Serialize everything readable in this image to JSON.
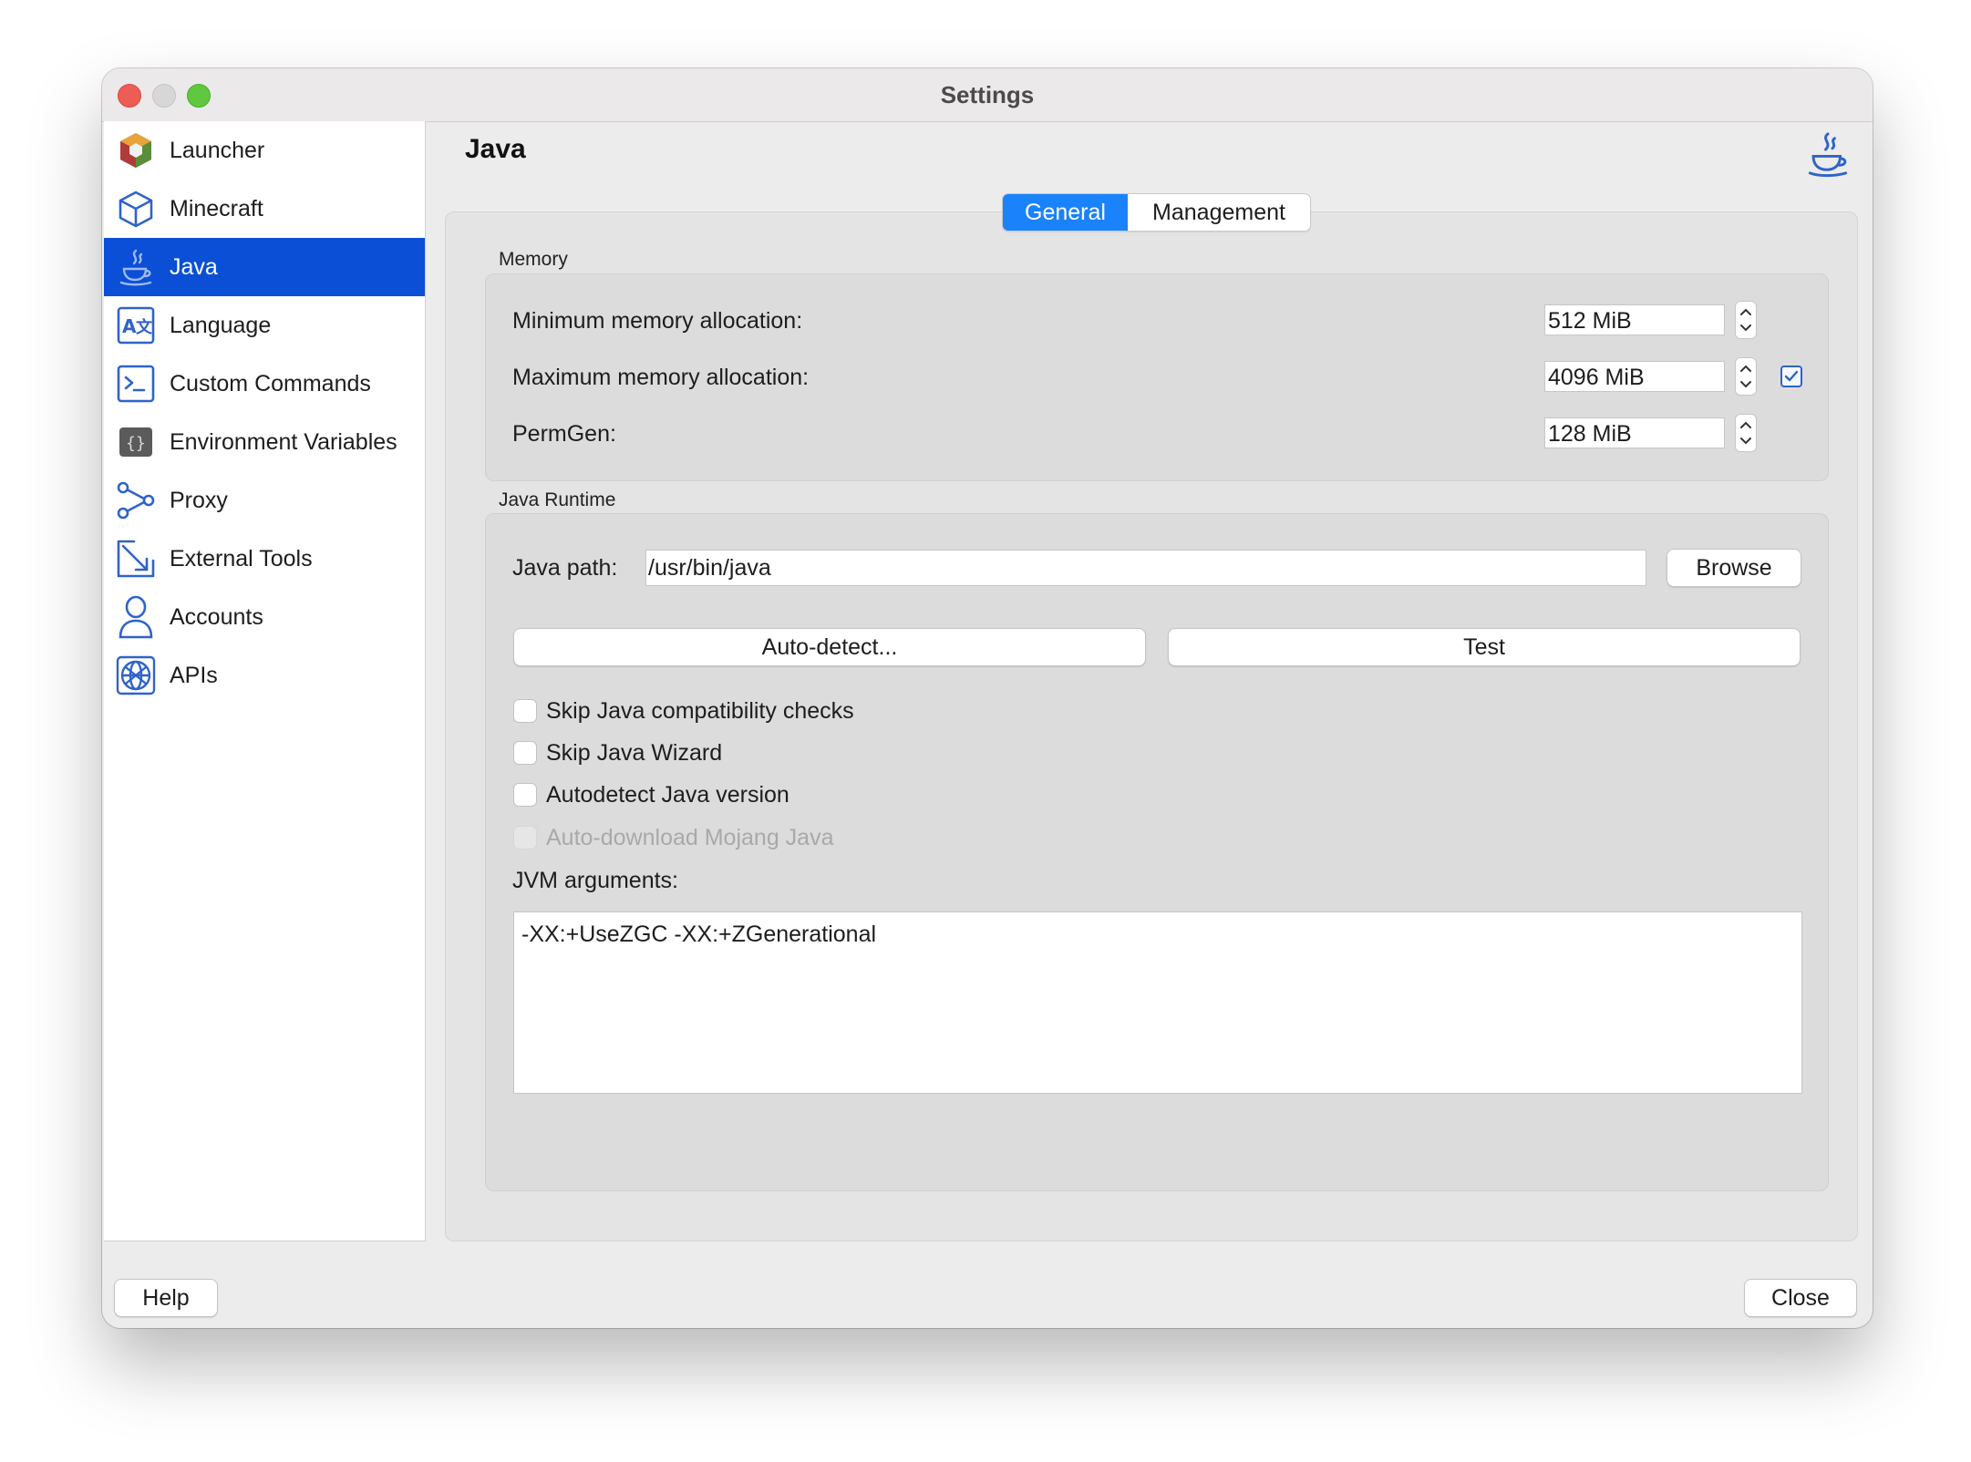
{
  "window": {
    "title": "Settings"
  },
  "sidebar": {
    "items": [
      {
        "label": "Launcher",
        "icon": "launcher-icon"
      },
      {
        "label": "Minecraft",
        "icon": "cube-icon"
      },
      {
        "label": "Java",
        "icon": "java-cup-icon",
        "active": true
      },
      {
        "label": "Language",
        "icon": "translate-icon"
      },
      {
        "label": "Custom Commands",
        "icon": "terminal-icon"
      },
      {
        "label": "Environment Variables",
        "icon": "env-braces-icon"
      },
      {
        "label": "Proxy",
        "icon": "share-nodes-icon"
      },
      {
        "label": "External Tools",
        "icon": "external-arrow-icon"
      },
      {
        "label": "Accounts",
        "icon": "user-icon"
      },
      {
        "label": "APIs",
        "icon": "globe-icon"
      }
    ]
  },
  "page": {
    "title": "Java",
    "header_icon": "java-cup-icon"
  },
  "tabs": [
    {
      "label": "General",
      "active": true
    },
    {
      "label": "Management",
      "active": false
    }
  ],
  "memory": {
    "title": "Memory",
    "min_label": "Minimum memory allocation:",
    "min_value": "512 MiB",
    "max_label": "Maximum memory allocation:",
    "max_value": "4096 MiB",
    "permgen_label": "PermGen:",
    "permgen_value": "128 MiB"
  },
  "runtime": {
    "title": "Java Runtime",
    "path_label": "Java path:",
    "path_value": "/usr/bin/java",
    "browse_label": "Browse",
    "autodetect_label": "Auto-detect...",
    "test_label": "Test",
    "checks": [
      {
        "label": "Skip Java compatibility checks",
        "checked": false,
        "disabled": false
      },
      {
        "label": "Skip Java Wizard",
        "checked": false,
        "disabled": false
      },
      {
        "label": "Autodetect Java version",
        "checked": false,
        "disabled": false
      },
      {
        "label": "Auto-download Mojang Java",
        "checked": false,
        "disabled": true
      }
    ],
    "jvm_label": "JVM arguments:",
    "jvm_value": "-XX:+UseZGC -XX:+ZGenerational"
  },
  "footer": {
    "help_label": "Help",
    "close_label": "Close"
  },
  "colors": {
    "accent": "#0b4fd6",
    "tab_active": "#1a82fb"
  }
}
